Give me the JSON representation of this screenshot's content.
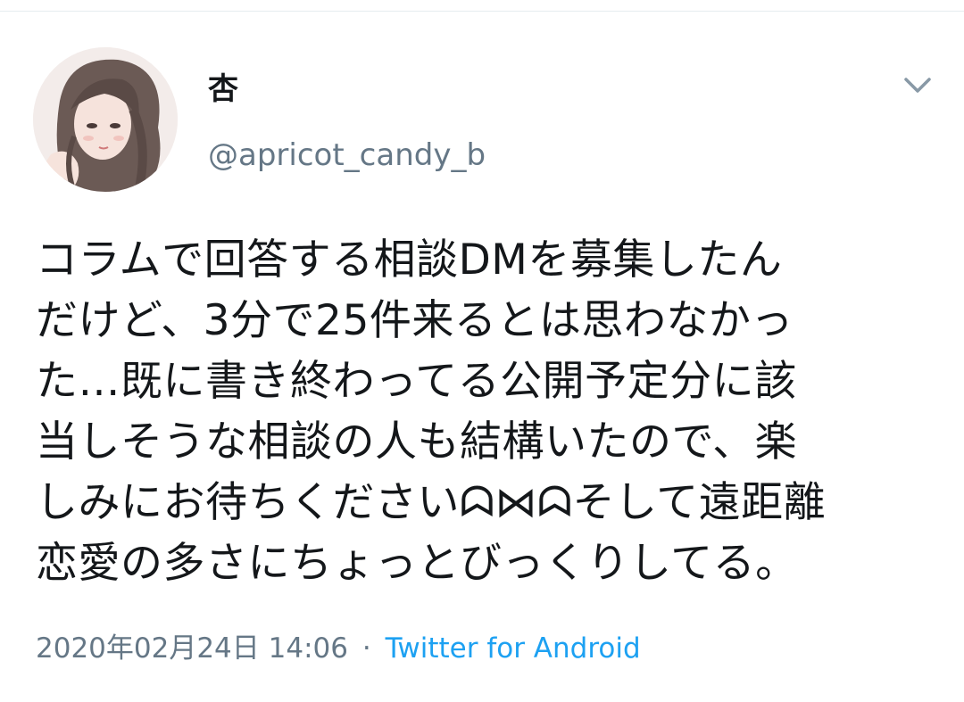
{
  "tweet": {
    "author": {
      "display_name": "杏",
      "handle": "@apricot_candy_b",
      "avatar_icon": "avatar-illustration"
    },
    "menu_icon": "chevron-down-icon",
    "text": "コラムで回答する相談DMを募集したん\nだけど、3分で25件来るとは思わなかっ\nた…既に書き終わってる公開予定分に該\n当しそうな相談の人も結構いたので、楽\nしみにお待ちくださいᗣ⋈ᗣそして遠距離\n恋愛の多さにちょっとびっくりしてる。",
    "timestamp": "2020年02月24日 14:06",
    "separator": "·",
    "source": "Twitter for Android"
  },
  "colors": {
    "text": "#14171a",
    "secondary": "#657786",
    "link": "#1da1f2"
  }
}
